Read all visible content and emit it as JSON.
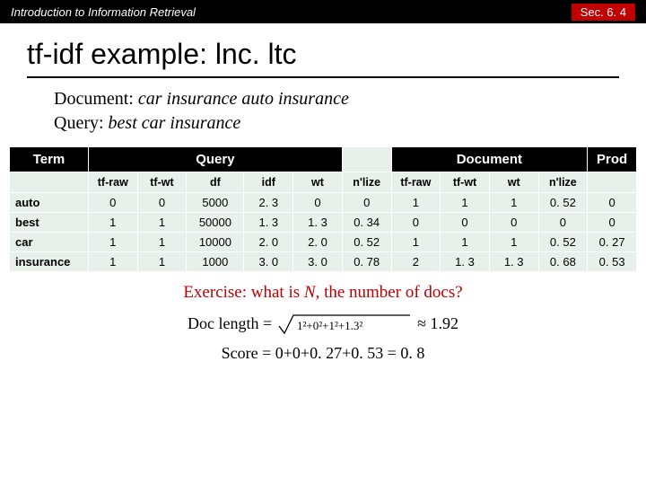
{
  "topbar": {
    "left": "Introduction to Information Retrieval",
    "right": "Sec. 6. 4"
  },
  "title": "tf-idf example: lnc. ltc",
  "doc_label": "Document:",
  "doc_text": "car insurance auto insurance",
  "query_label": "Query:",
  "query_text": "best car insurance",
  "group_headers": {
    "term": "Term",
    "query": "Query",
    "document": "Document",
    "prod": "Prod"
  },
  "col_headers": {
    "tfrawq": "tf-raw",
    "tfwtq": "tf-wt",
    "df": "df",
    "idf": "idf",
    "wtq": "wt",
    "nlizeq": "n'lize",
    "tfrawd": "tf-raw",
    "tfwtd": "tf-wt",
    "wtd": "wt",
    "nlized": "n'lize"
  },
  "rows": [
    {
      "term": "auto",
      "tfrawq": "0",
      "tfwtq": "0",
      "df": "5000",
      "idf": "2. 3",
      "wtq": "0",
      "nlizeq": "0",
      "tfrawd": "1",
      "tfwtd": "1",
      "wtd": "1",
      "nlized": "0. 52",
      "prod": "0"
    },
    {
      "term": "best",
      "tfrawq": "1",
      "tfwtq": "1",
      "df": "50000",
      "idf": "1. 3",
      "wtq": "1. 3",
      "nlizeq": "0. 34",
      "tfrawd": "0",
      "tfwtd": "0",
      "wtd": "0",
      "nlized": "0",
      "prod": "0"
    },
    {
      "term": "car",
      "tfrawq": "1",
      "tfwtq": "1",
      "df": "10000",
      "idf": "2. 0",
      "wtq": "2. 0",
      "nlizeq": "0. 52",
      "tfrawd": "1",
      "tfwtd": "1",
      "wtd": "1",
      "nlized": "0. 52",
      "prod": "0. 27"
    },
    {
      "term": "insurance",
      "tfrawq": "1",
      "tfwtq": "1",
      "df": "1000",
      "idf": "3. 0",
      "wtq": "3. 0",
      "nlizeq": "0. 78",
      "tfrawd": "2",
      "tfwtd": "1. 3",
      "wtd": "1. 3",
      "nlized": "0. 68",
      "prod": "0. 53"
    }
  ],
  "exercise_pre": "Exercise: what is ",
  "exercise_n": "N",
  "exercise_post": ", the number of docs?",
  "doclen_label": "Doc length =",
  "doclen_expr": "√(1²+0²+1²+1.3²)",
  "doclen_approx": "≈ 1.92",
  "score": "Score = 0+0+0. 27+0. 53 = 0. 8"
}
